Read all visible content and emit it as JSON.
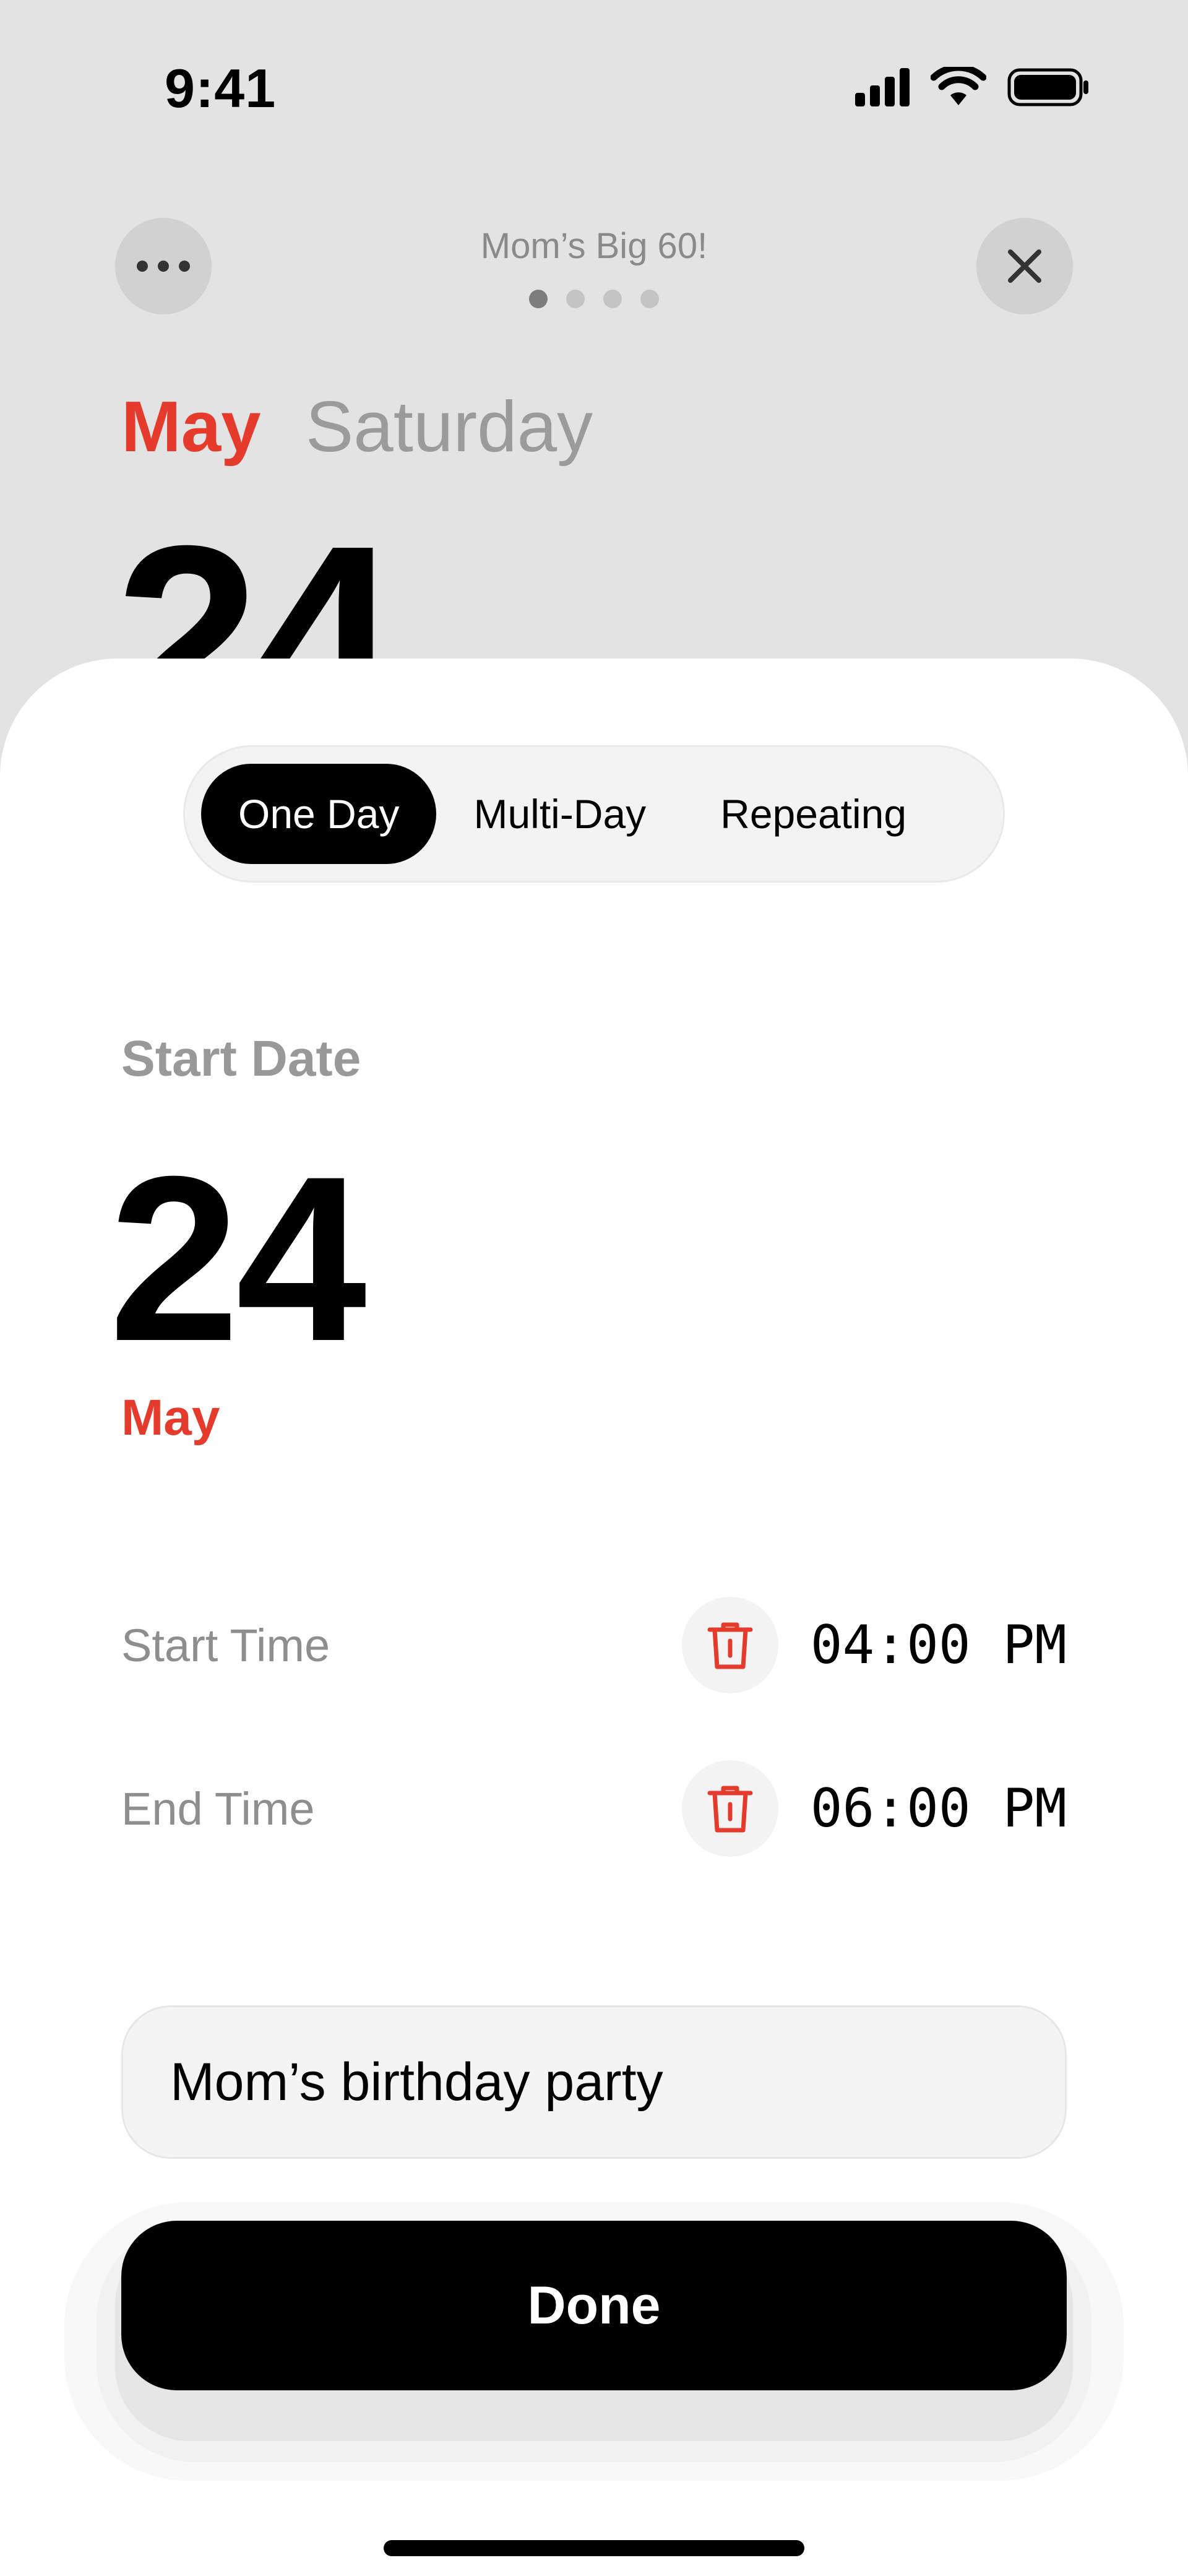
{
  "status_bar": {
    "time": "9:41",
    "icons": [
      "cellular-signal-icon",
      "wifi-icon",
      "battery-icon"
    ]
  },
  "header": {
    "title": "Mom’s Big 60!",
    "more_icon": "ellipsis-icon",
    "close_icon": "close-icon",
    "page_count": 4,
    "active_page": 1
  },
  "background_date": {
    "month": "May",
    "weekday": "Saturday",
    "day": "24"
  },
  "mode_tabs": [
    {
      "label": "One Day",
      "active": true
    },
    {
      "label": "Multi-Day",
      "active": false
    },
    {
      "label": "Repeating",
      "active": false
    }
  ],
  "start_date": {
    "label": "Start Date",
    "day": "24",
    "month": "May"
  },
  "times": {
    "start": {
      "label": "Start Time",
      "value": "04:00 PM"
    },
    "end": {
      "label": "End Time",
      "value": "06:00 PM"
    }
  },
  "event_title": {
    "value": "Mom’s birthday party"
  },
  "done_button": {
    "label": "Done"
  },
  "colors": {
    "accent": "#e53b2c",
    "background": "#e3e3e3",
    "sheet": "#ffffff",
    "primary": "#000000",
    "muted": "#999999"
  }
}
